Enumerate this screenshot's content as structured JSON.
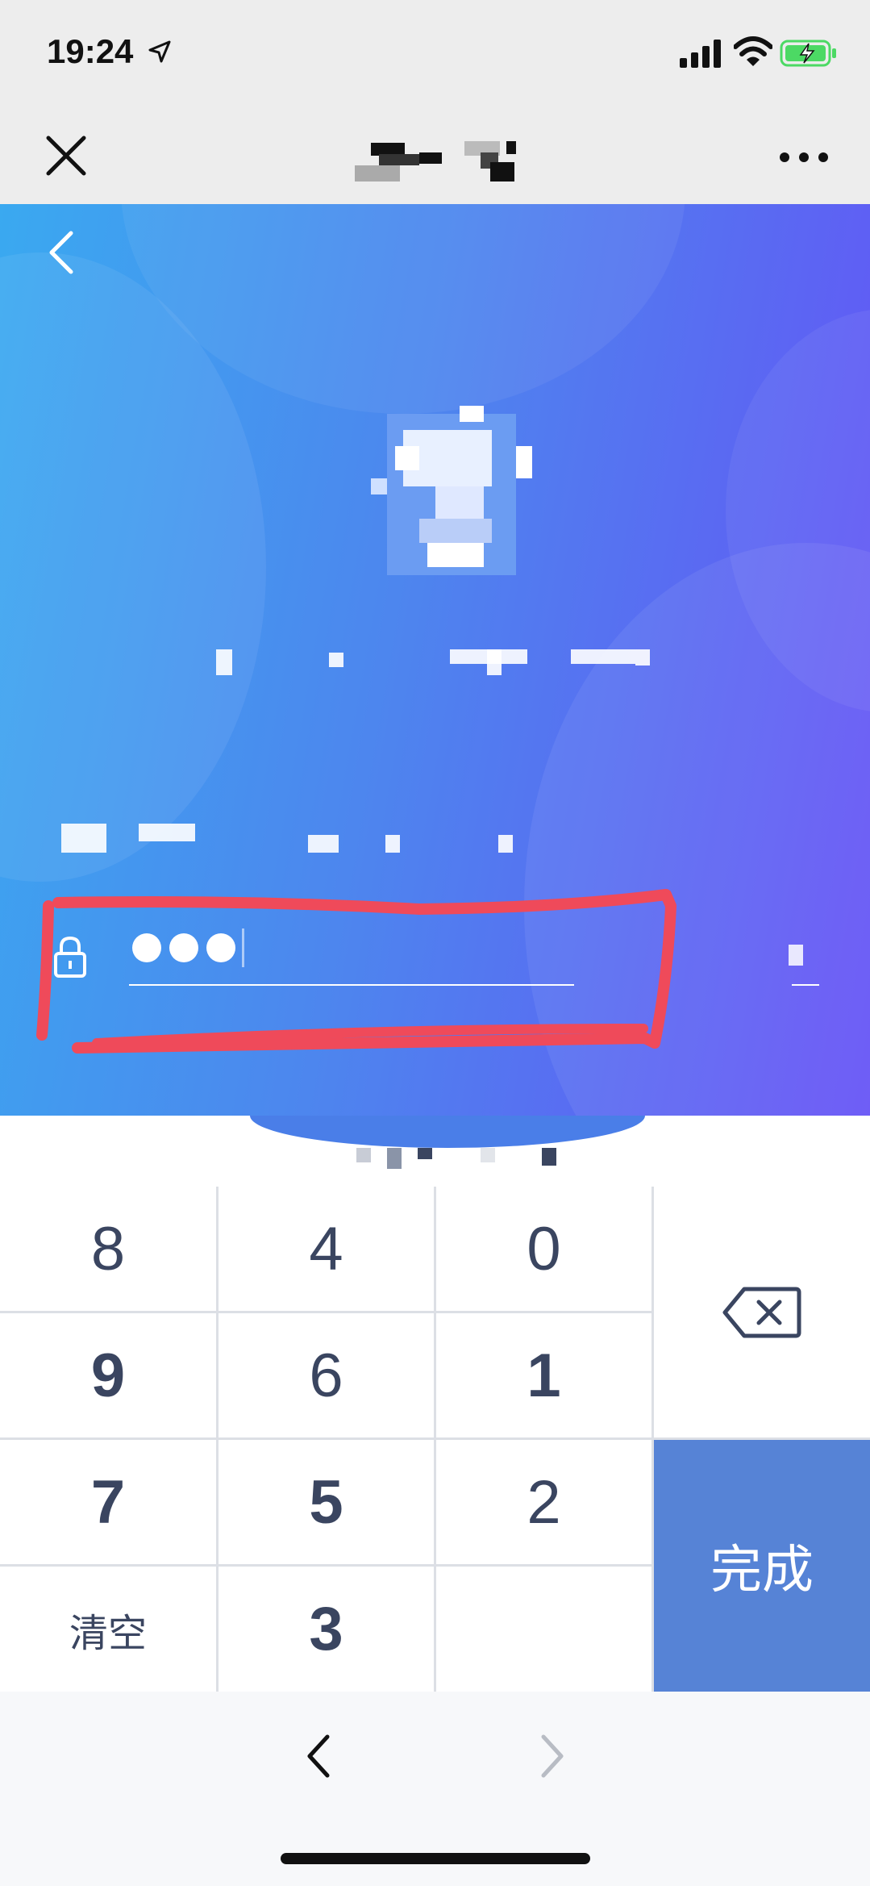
{
  "status_bar": {
    "time": "19:24"
  },
  "password": {
    "dots": 3,
    "masked_value": "●●●"
  },
  "keypad": {
    "rows": [
      [
        "8",
        "4",
        "0"
      ],
      [
        "9",
        "6",
        "1"
      ],
      [
        "7",
        "5",
        "2"
      ],
      [
        "清空",
        "3",
        ""
      ]
    ],
    "done_label": "完成",
    "clear_label": "清空"
  },
  "colors": {
    "hero_gradient_start": "#3aa9f0",
    "hero_gradient_end": "#6551f6",
    "done_key": "#5683d6",
    "key_text": "#3a4560",
    "annotation": "#ef4a5a"
  },
  "icons": [
    "location-arrow-icon",
    "signal-icon",
    "wifi-icon",
    "battery-icon",
    "close-icon",
    "more-icon",
    "back-icon",
    "lock-icon",
    "backspace-icon",
    "prev-icon",
    "next-icon"
  ]
}
